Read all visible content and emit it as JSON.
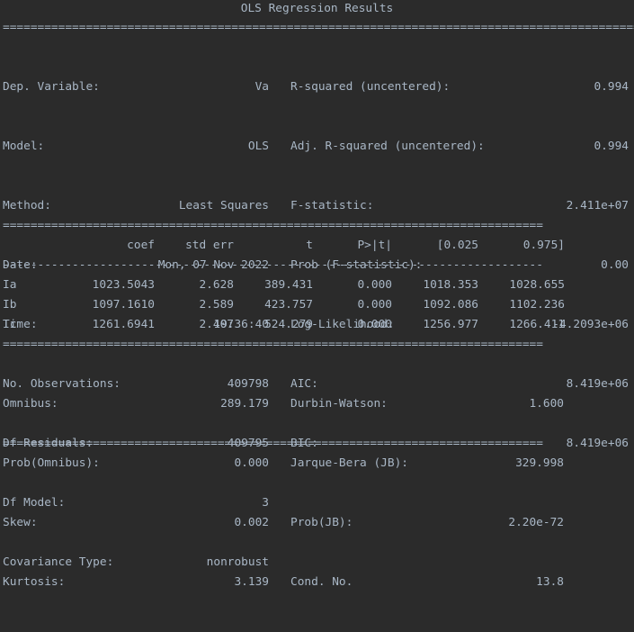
{
  "title": "OLS Regression Results",
  "rule_double_full": "==============================================================================================",
  "rule_double": "==============================================================================",
  "rule_single": "------------------------------------------------------------------------------",
  "summary_left": [
    {
      "label": "Dep. Variable:",
      "value": "Va"
    },
    {
      "label": "Model:",
      "value": "OLS"
    },
    {
      "label": "Method:",
      "value": "Least Squares"
    },
    {
      "label": "Date:",
      "value": "Mon, 07 Nov 2022"
    },
    {
      "label": "Time:",
      "value": "19:36:40"
    },
    {
      "label": "No. Observations:",
      "value": "409798"
    },
    {
      "label": "Df Residuals:",
      "value": "409795"
    },
    {
      "label": "Df Model:",
      "value": "3"
    },
    {
      "label": "Covariance Type:",
      "value": "nonrobust"
    }
  ],
  "summary_right": [
    {
      "label": "R-squared (uncentered):",
      "value": "0.994"
    },
    {
      "label": "Adj. R-squared (uncentered):",
      "value": "0.994"
    },
    {
      "label": "F-statistic:",
      "value": "2.411e+07"
    },
    {
      "label": "Prob (F-statistic):",
      "value": "0.00"
    },
    {
      "label": "Log-Likelihood:",
      "value": "-4.2093e+06"
    },
    {
      "label": "AIC:",
      "value": "8.419e+06"
    },
    {
      "label": "BIC:",
      "value": "8.419e+06"
    }
  ],
  "coef_headers": [
    "coef",
    "std err",
    "t",
    "P>|t|",
    "[0.025",
    "0.975]"
  ],
  "coef_rows": [
    {
      "name": "Ia",
      "values": [
        "1023.5043",
        "2.628",
        "389.431",
        "0.000",
        "1018.353",
        "1028.655"
      ]
    },
    {
      "name": "Ib",
      "values": [
        "1097.1610",
        "2.589",
        "423.757",
        "0.000",
        "1092.086",
        "1102.236"
      ]
    },
    {
      "name": "Ic",
      "values": [
        "1261.6941",
        "2.407",
        "524.279",
        "0.000",
        "1256.977",
        "1266.411"
      ]
    }
  ],
  "diag_left": [
    {
      "label": "Omnibus:",
      "value": "289.179"
    },
    {
      "label": "Prob(Omnibus):",
      "value": "0.000"
    },
    {
      "label": "Skew:",
      "value": "0.002"
    },
    {
      "label": "Kurtosis:",
      "value": "3.139"
    }
  ],
  "diag_right": [
    {
      "label": "Durbin-Watson:",
      "value": "1.600"
    },
    {
      "label": "Jarque-Bera (JB):",
      "value": "329.998"
    },
    {
      "label": "Prob(JB):",
      "value": "2.20e-72"
    },
    {
      "label": "Cond. No.",
      "value": "13.8"
    }
  ]
}
